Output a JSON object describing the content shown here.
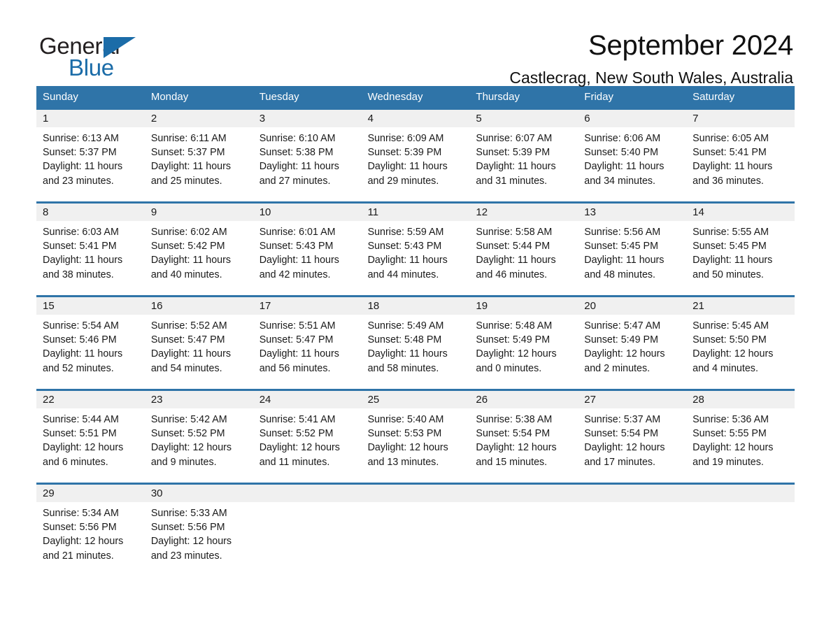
{
  "brand": {
    "name_part1": "General",
    "name_part2": "Blue",
    "triangle_color": "#1b6ca8",
    "text_color": "#231f20"
  },
  "header": {
    "title": "September 2024",
    "location": "Castlecrag, New South Wales, Australia"
  },
  "theme": {
    "header_blue": "#2f74a8",
    "row_rule_blue": "#2f74a8",
    "daynum_band_gray": "#f0f0f0",
    "page_background": "#ffffff",
    "text_color": "#1a1a1a"
  },
  "calendar": {
    "day_headers": [
      "Sunday",
      "Monday",
      "Tuesday",
      "Wednesday",
      "Thursday",
      "Friday",
      "Saturday"
    ],
    "weeks": [
      {
        "days": [
          {
            "number": "1",
            "sunrise": "Sunrise: 6:13 AM",
            "sunset": "Sunset: 5:37 PM",
            "daylight": "Daylight: 11 hours and 23 minutes."
          },
          {
            "number": "2",
            "sunrise": "Sunrise: 6:11 AM",
            "sunset": "Sunset: 5:37 PM",
            "daylight": "Daylight: 11 hours and 25 minutes."
          },
          {
            "number": "3",
            "sunrise": "Sunrise: 6:10 AM",
            "sunset": "Sunset: 5:38 PM",
            "daylight": "Daylight: 11 hours and 27 minutes."
          },
          {
            "number": "4",
            "sunrise": "Sunrise: 6:09 AM",
            "sunset": "Sunset: 5:39 PM",
            "daylight": "Daylight: 11 hours and 29 minutes."
          },
          {
            "number": "5",
            "sunrise": "Sunrise: 6:07 AM",
            "sunset": "Sunset: 5:39 PM",
            "daylight": "Daylight: 11 hours and 31 minutes."
          },
          {
            "number": "6",
            "sunrise": "Sunrise: 6:06 AM",
            "sunset": "Sunset: 5:40 PM",
            "daylight": "Daylight: 11 hours and 34 minutes."
          },
          {
            "number": "7",
            "sunrise": "Sunrise: 6:05 AM",
            "sunset": "Sunset: 5:41 PM",
            "daylight": "Daylight: 11 hours and 36 minutes."
          }
        ]
      },
      {
        "days": [
          {
            "number": "8",
            "sunrise": "Sunrise: 6:03 AM",
            "sunset": "Sunset: 5:41 PM",
            "daylight": "Daylight: 11 hours and 38 minutes."
          },
          {
            "number": "9",
            "sunrise": "Sunrise: 6:02 AM",
            "sunset": "Sunset: 5:42 PM",
            "daylight": "Daylight: 11 hours and 40 minutes."
          },
          {
            "number": "10",
            "sunrise": "Sunrise: 6:01 AM",
            "sunset": "Sunset: 5:43 PM",
            "daylight": "Daylight: 11 hours and 42 minutes."
          },
          {
            "number": "11",
            "sunrise": "Sunrise: 5:59 AM",
            "sunset": "Sunset: 5:43 PM",
            "daylight": "Daylight: 11 hours and 44 minutes."
          },
          {
            "number": "12",
            "sunrise": "Sunrise: 5:58 AM",
            "sunset": "Sunset: 5:44 PM",
            "daylight": "Daylight: 11 hours and 46 minutes."
          },
          {
            "number": "13",
            "sunrise": "Sunrise: 5:56 AM",
            "sunset": "Sunset: 5:45 PM",
            "daylight": "Daylight: 11 hours and 48 minutes."
          },
          {
            "number": "14",
            "sunrise": "Sunrise: 5:55 AM",
            "sunset": "Sunset: 5:45 PM",
            "daylight": "Daylight: 11 hours and 50 minutes."
          }
        ]
      },
      {
        "days": [
          {
            "number": "15",
            "sunrise": "Sunrise: 5:54 AM",
            "sunset": "Sunset: 5:46 PM",
            "daylight": "Daylight: 11 hours and 52 minutes."
          },
          {
            "number": "16",
            "sunrise": "Sunrise: 5:52 AM",
            "sunset": "Sunset: 5:47 PM",
            "daylight": "Daylight: 11 hours and 54 minutes."
          },
          {
            "number": "17",
            "sunrise": "Sunrise: 5:51 AM",
            "sunset": "Sunset: 5:47 PM",
            "daylight": "Daylight: 11 hours and 56 minutes."
          },
          {
            "number": "18",
            "sunrise": "Sunrise: 5:49 AM",
            "sunset": "Sunset: 5:48 PM",
            "daylight": "Daylight: 11 hours and 58 minutes."
          },
          {
            "number": "19",
            "sunrise": "Sunrise: 5:48 AM",
            "sunset": "Sunset: 5:49 PM",
            "daylight": "Daylight: 12 hours and 0 minutes."
          },
          {
            "number": "20",
            "sunrise": "Sunrise: 5:47 AM",
            "sunset": "Sunset: 5:49 PM",
            "daylight": "Daylight: 12 hours and 2 minutes."
          },
          {
            "number": "21",
            "sunrise": "Sunrise: 5:45 AM",
            "sunset": "Sunset: 5:50 PM",
            "daylight": "Daylight: 12 hours and 4 minutes."
          }
        ]
      },
      {
        "days": [
          {
            "number": "22",
            "sunrise": "Sunrise: 5:44 AM",
            "sunset": "Sunset: 5:51 PM",
            "daylight": "Daylight: 12 hours and 6 minutes."
          },
          {
            "number": "23",
            "sunrise": "Sunrise: 5:42 AM",
            "sunset": "Sunset: 5:52 PM",
            "daylight": "Daylight: 12 hours and 9 minutes."
          },
          {
            "number": "24",
            "sunrise": "Sunrise: 5:41 AM",
            "sunset": "Sunset: 5:52 PM",
            "daylight": "Daylight: 12 hours and 11 minutes."
          },
          {
            "number": "25",
            "sunrise": "Sunrise: 5:40 AM",
            "sunset": "Sunset: 5:53 PM",
            "daylight": "Daylight: 12 hours and 13 minutes."
          },
          {
            "number": "26",
            "sunrise": "Sunrise: 5:38 AM",
            "sunset": "Sunset: 5:54 PM",
            "daylight": "Daylight: 12 hours and 15 minutes."
          },
          {
            "number": "27",
            "sunrise": "Sunrise: 5:37 AM",
            "sunset": "Sunset: 5:54 PM",
            "daylight": "Daylight: 12 hours and 17 minutes."
          },
          {
            "number": "28",
            "sunrise": "Sunrise: 5:36 AM",
            "sunset": "Sunset: 5:55 PM",
            "daylight": "Daylight: 12 hours and 19 minutes."
          }
        ]
      },
      {
        "days": [
          {
            "number": "29",
            "sunrise": "Sunrise: 5:34 AM",
            "sunset": "Sunset: 5:56 PM",
            "daylight": "Daylight: 12 hours and 21 minutes."
          },
          {
            "number": "30",
            "sunrise": "Sunrise: 5:33 AM",
            "sunset": "Sunset: 5:56 PM",
            "daylight": "Daylight: 12 hours and 23 minutes."
          },
          {
            "number": "",
            "sunrise": "",
            "sunset": "",
            "daylight": ""
          },
          {
            "number": "",
            "sunrise": "",
            "sunset": "",
            "daylight": ""
          },
          {
            "number": "",
            "sunrise": "",
            "sunset": "",
            "daylight": ""
          },
          {
            "number": "",
            "sunrise": "",
            "sunset": "",
            "daylight": ""
          },
          {
            "number": "",
            "sunrise": "",
            "sunset": "",
            "daylight": ""
          }
        ]
      }
    ]
  }
}
